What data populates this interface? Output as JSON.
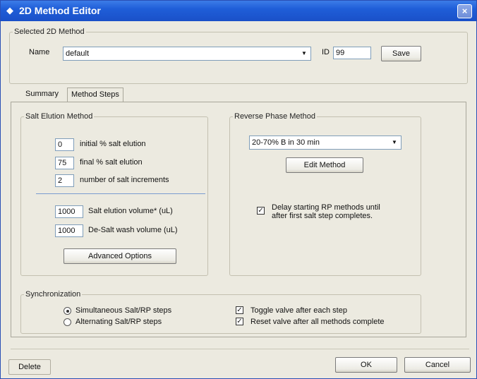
{
  "window": {
    "title": "2D Method Editor",
    "close_glyph": "×"
  },
  "selected_method": {
    "legend": "Selected 2D Method",
    "name_label": "Name",
    "name_value": "default",
    "id_label": "ID",
    "id_value": "99",
    "save_label": "Save"
  },
  "tabs": [
    {
      "label": "Summary"
    },
    {
      "label": "Method Steps"
    }
  ],
  "salt": {
    "legend": "Salt Elution Method",
    "fields": [
      {
        "value": "0",
        "label": "initial % salt elution"
      },
      {
        "value": "75",
        "label": "final % salt elution"
      },
      {
        "value": "2",
        "label": "number of salt increments"
      },
      {
        "value": "1000",
        "label": "Salt elution volume* (uL)"
      },
      {
        "value": "1000",
        "label": "De-Salt wash volume (uL)"
      }
    ],
    "advanced_label": "Advanced Options"
  },
  "rp": {
    "legend": "Reverse Phase Method",
    "selected": "20-70% B in 30 min",
    "edit_label": "Edit Method",
    "delay_label_1": "Delay starting RP methods until",
    "delay_label_2": "after first salt step completes.",
    "delay_checked": true
  },
  "sync": {
    "legend": "Synchronization",
    "options": [
      {
        "label": "Simultaneous Salt/RP steps",
        "selected": true
      },
      {
        "label": "Alternating Salt/RP steps",
        "selected": false
      }
    ],
    "checks": [
      {
        "label": "Toggle valve after each step",
        "checked": true
      },
      {
        "label": "Reset valve after all methods complete",
        "checked": true
      }
    ]
  },
  "footer": {
    "delete_label": "Delete",
    "ok_label": "OK",
    "cancel_label": "Cancel"
  },
  "colors": {
    "title_bar": "#1f5ed8",
    "dialog_bg": "#eceae0"
  }
}
